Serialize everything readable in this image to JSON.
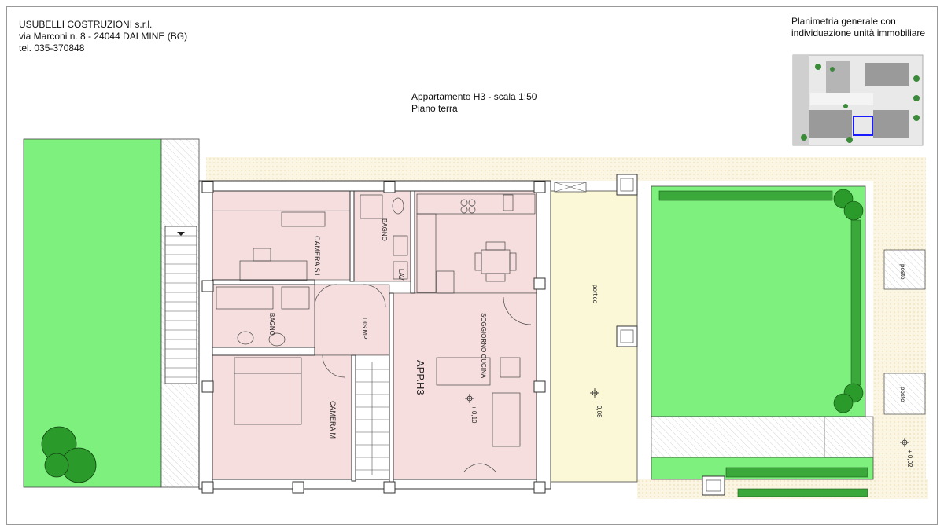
{
  "company": {
    "name": "USUBELLI COSTRUZIONI s.r.l.",
    "address": "via Marconi n. 8 - 24044 DALMINE (BG)",
    "phone": "tel. 035-370848"
  },
  "drawing": {
    "title": "Appartamento H3 - scala 1:50",
    "floor": "Piano terra"
  },
  "site_plan": {
    "title_line1": "Planimetria generale con",
    "title_line2": "individuazione unità immobiliare",
    "highlight_color": "#1a1aff"
  },
  "rooms": {
    "camera_s1": "CAMERA S1",
    "bagno_top": "BAGNO",
    "bagno_left": "BAGNO",
    "disimp": "DISIMP.",
    "camera_m": "CAMERA M",
    "soggiorno": "SOGGIORNO CUCINA",
    "apartment": "APP.H3",
    "portico": "portico",
    "lav": "LAV"
  },
  "levels": {
    "apartment": "+ 0,10",
    "portico": "+ 0,08",
    "garden": "+ 0,02"
  },
  "parking": {
    "label1": "posto",
    "label2": "posto"
  },
  "colors": {
    "room_fill": "#f7dede",
    "garden_fill": "#7ef07e",
    "portico_fill": "#fbf8d8",
    "hatch": "#f3d9a0",
    "wall": "#ffffff"
  }
}
